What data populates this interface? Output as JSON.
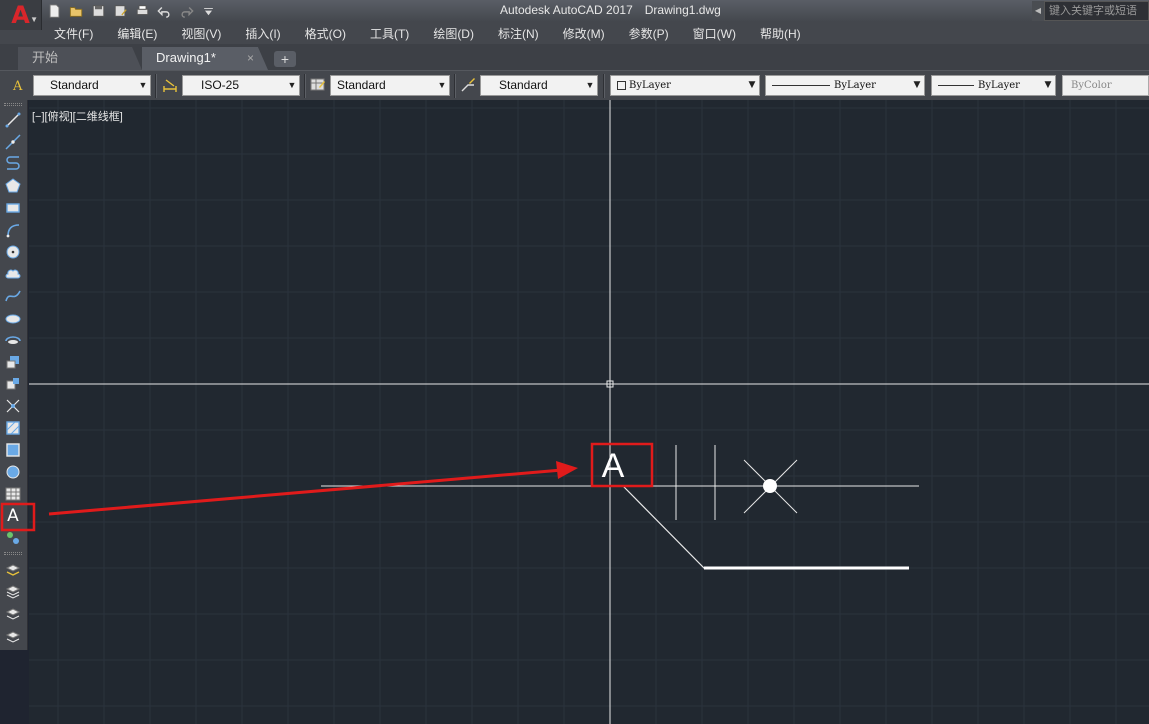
{
  "app": {
    "title": "Autodesk AutoCAD 2017",
    "document": "Drawing1.dwg",
    "logo_letter": "A",
    "search_placeholder": "键入关键字或短语"
  },
  "menu": [
    "文件(F)",
    "编辑(E)",
    "视图(V)",
    "插入(I)",
    "格式(O)",
    "工具(T)",
    "绘图(D)",
    "标注(N)",
    "修改(M)",
    "参数(P)",
    "窗口(W)",
    "帮助(H)"
  ],
  "tabs": {
    "start": "开始",
    "drawing": "Drawing1*",
    "close_glyph": "×",
    "add_glyph": "+"
  },
  "styles_toolbar": {
    "text_style": "Standard",
    "dim_style": "ISO-25",
    "table_style": "Standard",
    "multileader_style": "Standard",
    "layer_color": "ByLayer",
    "linetype": "ByLayer",
    "lineweight": "ByLayer",
    "plot_style": "ByColor"
  },
  "canvas": {
    "viewport_label": "[−][俯视][二维线框]",
    "highlight_letter": "A",
    "background_color": "#212830",
    "grid_color": "#2b333d",
    "highlight_color": "#e01b1b"
  },
  "palette": {
    "text_tool_glyph": "A"
  },
  "icons": {
    "qat": [
      "new-icon",
      "open-icon",
      "save-icon",
      "saveas-icon",
      "plot-icon",
      "undo-icon",
      "redo-icon",
      "customize-icon"
    ],
    "tools": [
      "line-icon",
      "construction-line-icon",
      "polyline-icon",
      "polygon-icon",
      "rectangle-icon",
      "arc-icon",
      "circle-icon",
      "revision-cloud-icon",
      "spline-icon",
      "ellipse-icon",
      "ellipse-arc-icon",
      "insert-block-icon",
      "make-block-icon",
      "point-icon",
      "hatch-icon",
      "gradient-icon",
      "region-icon",
      "table-icon",
      "multiline-text-icon",
      "add-selected-icon"
    ]
  }
}
